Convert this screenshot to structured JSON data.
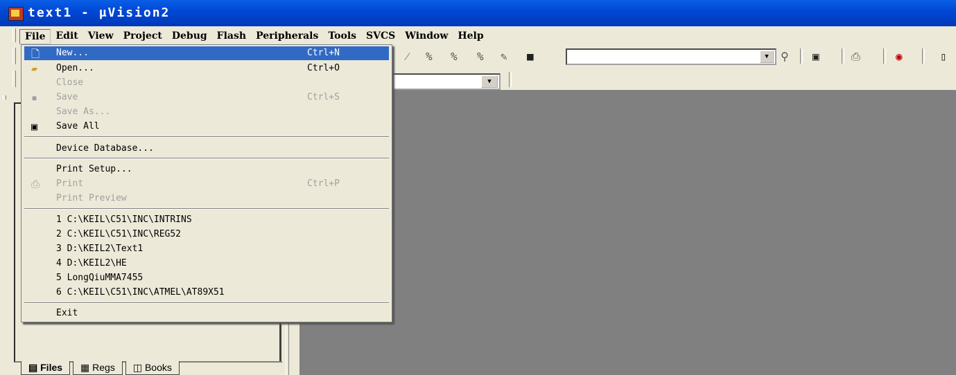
{
  "window": {
    "title": "text1  - μVision2"
  },
  "menubar": {
    "items": [
      "File",
      "Edit",
      "View",
      "Project",
      "Debug",
      "Flash",
      "Peripherals",
      "Tools",
      "SVCS",
      "Window",
      "Help"
    ]
  },
  "file_menu": {
    "new": {
      "label": "New...",
      "shortcut": "Ctrl+N"
    },
    "open": {
      "label": "Open...",
      "shortcut": "Ctrl+O"
    },
    "close": {
      "label": "Close"
    },
    "save": {
      "label": "Save",
      "shortcut": "Ctrl+S"
    },
    "save_as": {
      "label": "Save As..."
    },
    "save_all": {
      "label": "Save All"
    },
    "device_db": {
      "label": "Device Database..."
    },
    "print_setup": {
      "label": "Print Setup..."
    },
    "print": {
      "label": "Print",
      "shortcut": "Ctrl+P"
    },
    "print_preview": {
      "label": "Print Preview"
    },
    "recent": [
      "1 C:\\KEIL\\C51\\INC\\INTRINS",
      "2 C:\\KEIL\\C51\\INC\\REG52",
      "3 D:\\KEIL2\\Text1",
      "4 D:\\KEIL2\\HE",
      "5 LongQiuMMA7455",
      "6 C:\\KEIL\\C51\\INC\\ATMEL\\AT89X51"
    ],
    "exit": {
      "label": "Exit"
    }
  },
  "left_tabs": [
    "Files",
    "Regs",
    "Books"
  ],
  "colors": {
    "titlebar": "#0049d6",
    "menu_bg": "#ece9d8",
    "highlight": "#316ac5",
    "workspace": "#808080"
  }
}
